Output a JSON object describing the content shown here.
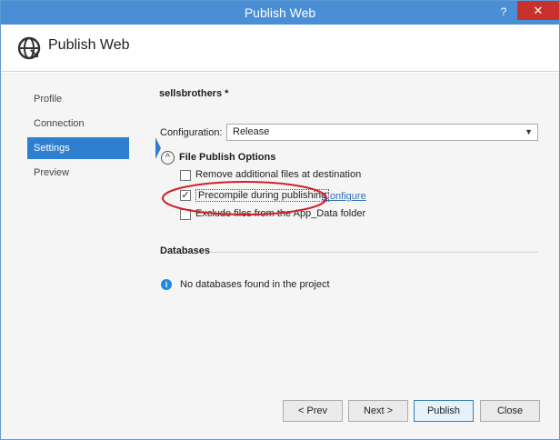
{
  "window": {
    "title": "Publish Web",
    "help": "?",
    "close": "✕"
  },
  "header": {
    "title": "Publish Web",
    "icon": "globe-icon"
  },
  "nav": {
    "items": [
      {
        "label": "Profile"
      },
      {
        "label": "Connection"
      },
      {
        "label": "Settings",
        "selected": true
      },
      {
        "label": "Preview"
      }
    ]
  },
  "settings": {
    "profile_name": "sellsbrothers *",
    "configuration_label": "Configuration:",
    "configuration_value": "Release",
    "file_publish_options_title": "File Publish Options",
    "options": [
      {
        "label": "Remove additional files at destination",
        "checked": false
      },
      {
        "label": "Precompile during publishing",
        "checked": true
      },
      {
        "label": "Exclude files from the App_Data folder",
        "checked": false
      }
    ],
    "configure_link": "Configure"
  },
  "databases": {
    "title": "Databases",
    "message": "No databases found in the project"
  },
  "buttons": {
    "prev": "< Prev",
    "next": "Next >",
    "publish": "Publish",
    "close": "Close"
  },
  "colors": {
    "titlebar": "#4a8fd6",
    "selected_nav": "#2f7fd0",
    "annotation": "#d0202a"
  }
}
